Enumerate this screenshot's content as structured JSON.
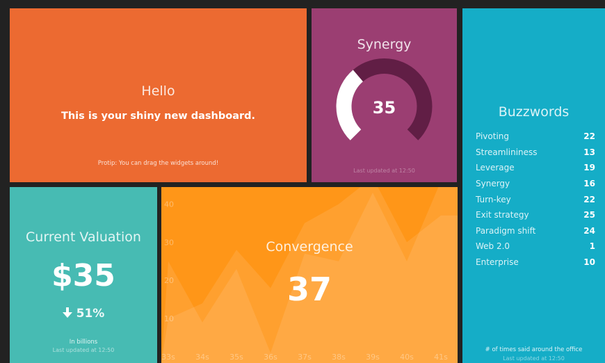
{
  "colors": {
    "background": "#222222",
    "hello": "#ec6a31",
    "synergy": "#9b3e72",
    "buzzwords": "#15adc7",
    "valuation": "#47bbb3",
    "convergence": "#ff9618"
  },
  "hello": {
    "title": "Hello",
    "text": "This is your shiny new dashboard.",
    "moreinfo": "Protip: You can drag the widgets around!"
  },
  "synergy": {
    "title": "Synergy",
    "value": "35",
    "min": 0,
    "max": 100,
    "updated": "Last updated at 12:50"
  },
  "buzzwords": {
    "title": "Buzzwords",
    "items": [
      {
        "label": "Pivoting",
        "value": "22"
      },
      {
        "label": "Streamlininess",
        "value": "13"
      },
      {
        "label": "Leverage",
        "value": "19"
      },
      {
        "label": "Synergy",
        "value": "16"
      },
      {
        "label": "Turn-key",
        "value": "22"
      },
      {
        "label": "Exit strategy",
        "value": "25"
      },
      {
        "label": "Paradigm shift",
        "value": "24"
      },
      {
        "label": "Web 2.0",
        "value": "1"
      },
      {
        "label": "Enterprise",
        "value": "10"
      }
    ],
    "moreinfo": "# of times said around the office",
    "updated": "Last updated at 12:50"
  },
  "valuation": {
    "title": "Current Valuation",
    "value": "$35",
    "change": "51%",
    "change_icon": "arrow-down-icon",
    "moreinfo": "In billions",
    "updated": "Last updated at 12:50"
  },
  "convergence": {
    "title": "Convergence",
    "value": "37"
  },
  "chart_data": {
    "type": "area",
    "x": [
      "33s",
      "34s",
      "35s",
      "36s",
      "37s",
      "38s",
      "39s",
      "40s",
      "41s"
    ],
    "y_ticks": [
      10,
      20,
      30,
      40
    ],
    "ylim": [
      0,
      43
    ],
    "series": [
      {
        "values": [
          10,
          14,
          28,
          18,
          35,
          40,
          47,
          30,
          37
        ]
      },
      {
        "values": [
          25,
          9,
          23,
          1,
          27,
          25,
          43,
          25,
          46
        ]
      }
    ],
    "grid": false
  }
}
